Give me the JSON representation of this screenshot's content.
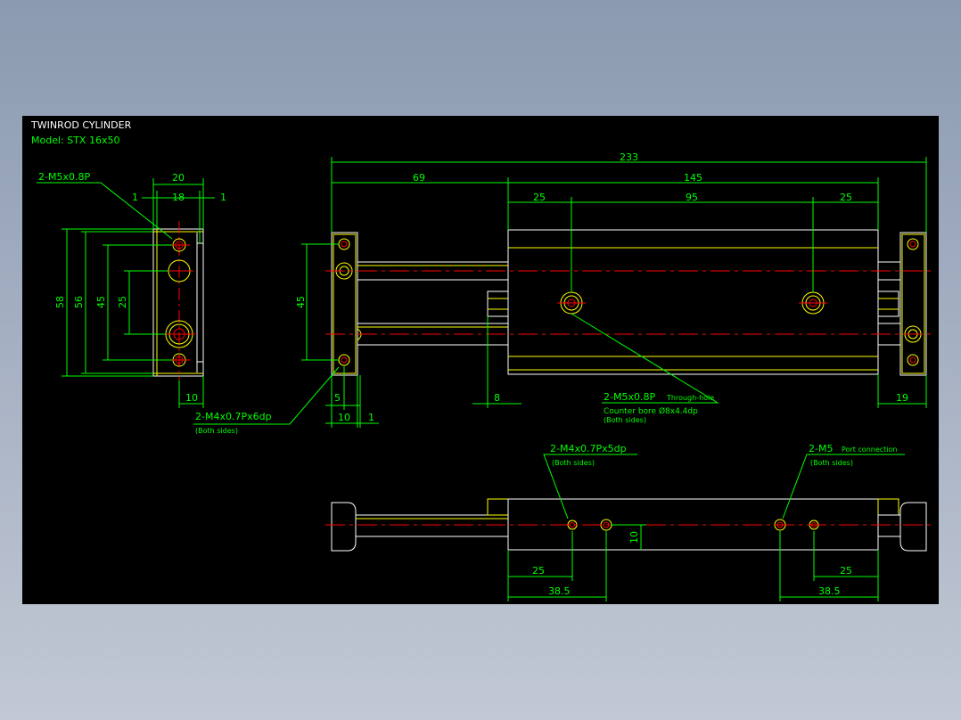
{
  "title": {
    "name": "TWINROD CYLINDER",
    "model": "Model: STX 16x50"
  },
  "colors": {
    "background": "#000000",
    "outline": "#ffffff",
    "part_edge": "#ffff00",
    "dimension": "#00ff00",
    "centerline": "#ff0000",
    "label": "#00ff00"
  },
  "notes": {
    "tapped_front": "2-M5x0.8P",
    "tapped_side": "2-M4x0.7Px6dp",
    "both_sides_a": "(Both sides)",
    "through_main": "2-M5x0.8P",
    "through_suffix": "Through-hole",
    "counter_bore": "Counter bore Ø8x4.4dp",
    "both_sides_b": "(Both sides)",
    "bottom_tap": "2-M4x0.7Px5dp",
    "both_sides_c": "(Both sides)",
    "port_main": "2-M5",
    "port_suffix": "Port connection",
    "both_sides_d": "(Both sides)"
  },
  "dimensions": {
    "end_width": "20",
    "end_inner": "18",
    "end_gap_left": "1",
    "end_gap_right": "1",
    "h58": "58",
    "h56": "56",
    "h45": "45",
    "h25": "25",
    "end_bottom": "10",
    "overall": "233",
    "rod_len": "69",
    "body_len": "145",
    "pitch_left": "25",
    "pitch_mid": "95",
    "pitch_right": "25",
    "side_h45": "45",
    "side_5": "5",
    "side_10": "10",
    "side_1": "1",
    "nut_8": "8",
    "right_19": "19",
    "bot_10": "10",
    "bot_25_left": "25",
    "bot_385_left": "38.5",
    "bot_25_right": "25",
    "bot_385_right": "38.5"
  }
}
